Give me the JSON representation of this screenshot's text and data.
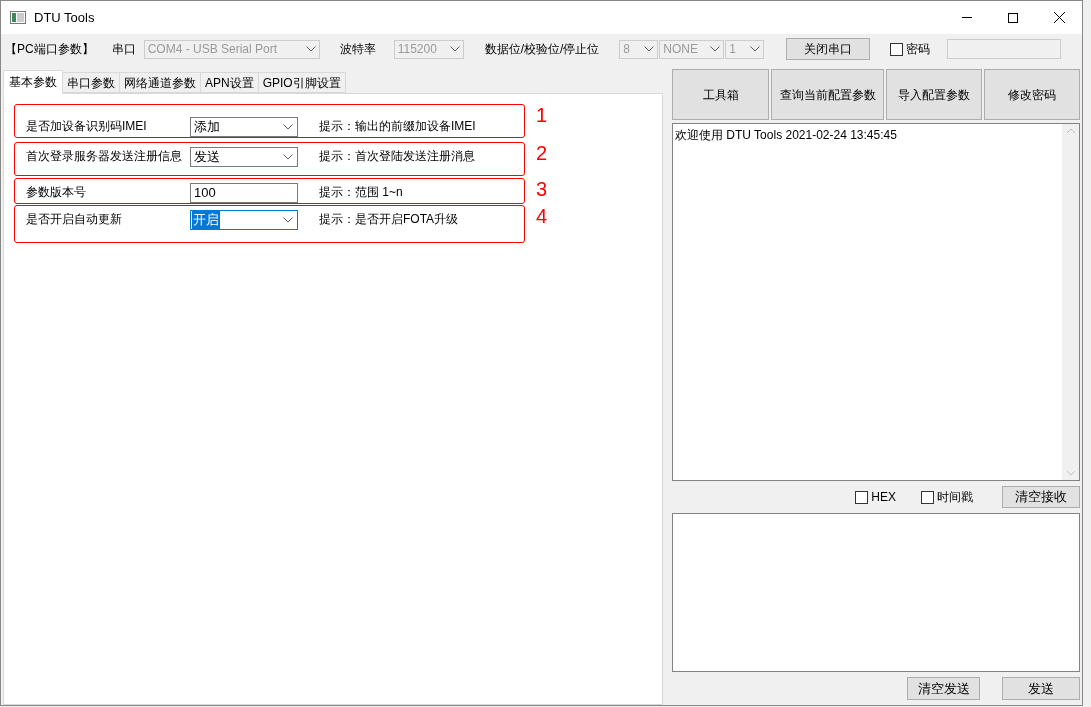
{
  "window": {
    "title": "DTU Tools"
  },
  "port_bar": {
    "heading": "【PC端口参数】",
    "port_label": "串口",
    "port": "COM4 - USB Serial Port",
    "baud_label": "波特率",
    "baud": "115200",
    "format_label": "数据位/校验位/停止位",
    "data_bits": "8",
    "parity": "NONE",
    "stop_bits": "1",
    "close_button": "关闭串口",
    "password": {
      "label": "密码",
      "checked": false
    }
  },
  "tabs": [
    {
      "label": "基本参数",
      "selected": true
    },
    {
      "label": "串口参数",
      "selected": false
    },
    {
      "label": "网络通道参数",
      "selected": false
    },
    {
      "label": "APN设置",
      "selected": false
    },
    {
      "label": "GPIO引脚设置",
      "selected": false
    }
  ],
  "params": [
    {
      "label": "是否加设备识别码IMEI",
      "kind": "select",
      "value": "添加",
      "focused": false,
      "hint": "提示：输出的前缀加设备IMEI",
      "marker": "1"
    },
    {
      "label": "首次登录服务器发送注册信息",
      "kind": "select",
      "value": "发送",
      "focused": false,
      "hint": "提示：首次登陆发送注册消息",
      "marker": "2"
    },
    {
      "label": "参数版本号",
      "kind": "input",
      "value": "100",
      "focused": false,
      "hint": "提示：范围 1~n",
      "marker": "3"
    },
    {
      "label": "是否开启自动更新",
      "kind": "select",
      "value": "开启",
      "focused": true,
      "hint": "提示：是否开启FOTA升级",
      "marker": "4"
    }
  ],
  "actions": [
    "工具箱",
    "查询当前配置参数",
    "导入配置参数",
    "修改密码"
  ],
  "receive_log": "欢迎使用 DTU Tools 2021-02-24 13:45:45",
  "options": [
    {
      "label": "HEX",
      "checked": false
    },
    {
      "label": "时间戳",
      "checked": false
    }
  ],
  "clear_receive": "清空接收",
  "clear_send": "清空发送",
  "send": "发送"
}
